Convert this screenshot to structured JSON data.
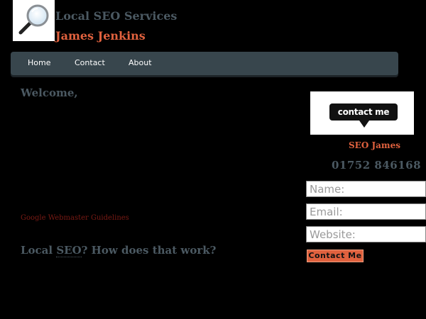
{
  "header": {
    "title": "Local SEO Services",
    "author": "James Jenkins",
    "logo_icon": "magnifying-glass-icon"
  },
  "nav": {
    "items": [
      {
        "label": "Home"
      },
      {
        "label": "Contact"
      },
      {
        "label": "About"
      }
    ]
  },
  "main": {
    "welcome": "Welcome,",
    "guidelines_link": "Google Webmaster Guidelines",
    "question_prefix": "Local ",
    "question_abbr": "SEO",
    "question_suffix": "? How does that work?"
  },
  "sidebar": {
    "contact_bubble": "contact me",
    "name": "SEO James",
    "phone": "01752 846168",
    "form": {
      "name_placeholder": "Name:",
      "email_placeholder": "Email:",
      "website_placeholder": "Website:",
      "submit_label": "Contact Me"
    }
  },
  "colors": {
    "background": "#000000",
    "accent": "#e0613e",
    "slate": "#4b5962",
    "nav": "#38464d"
  }
}
